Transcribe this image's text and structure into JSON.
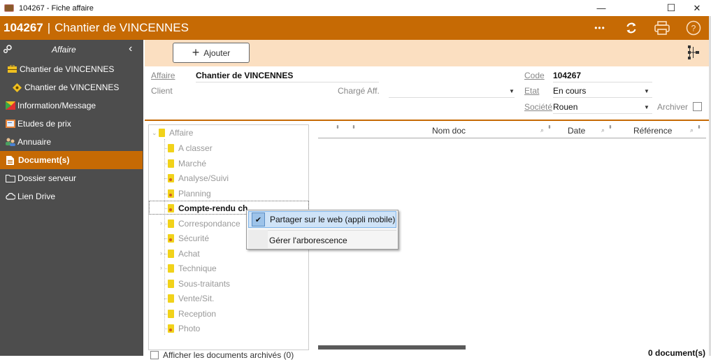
{
  "window": {
    "title": "104267 - Fiche affaire",
    "controls": {
      "minimize": "—",
      "maximize": "☐",
      "close": "✕"
    }
  },
  "header": {
    "code": "104267",
    "separator": "|",
    "name": "Chantier de VINCENNES",
    "icons": {
      "more": "•••",
      "refresh": "⟳",
      "print": "print-icon",
      "help": "?"
    }
  },
  "colors": {
    "accent": "#c66a04",
    "sidebar_bg": "#4d4d4d",
    "toolbar_bg": "#fbdfc1"
  },
  "sidebar": {
    "header_label": "Affaire",
    "collapse_glyph": "‹",
    "items": [
      {
        "label": "Chantier de VINCENNES",
        "icon": "briefcase-icon"
      },
      {
        "label": "Chantier de VINCENNES",
        "icon": "site-sign-icon"
      },
      {
        "label": "Information/Message",
        "icon": "message-flag-icon"
      },
      {
        "label": "Etudes de prix",
        "icon": "price-study-icon"
      },
      {
        "label": "Annuaire",
        "icon": "contacts-icon"
      },
      {
        "label": "Document(s)",
        "icon": "document-icon",
        "active": true
      },
      {
        "label": "Dossier serveur",
        "icon": "folder-icon"
      },
      {
        "label": "Lien Drive",
        "icon": "cloud-icon"
      }
    ]
  },
  "toolbar": {
    "add_label": "Ajouter",
    "add_glyph": "+"
  },
  "form": {
    "affaire_label": "Affaire",
    "affaire_value": "Chantier de VINCENNES",
    "client_label": "Client",
    "client_value": "",
    "charge_label": "Chargé Aff.",
    "charge_value": "",
    "code_label": "Code",
    "code_value": "104267",
    "etat_label": "Etat",
    "etat_value": "En cours",
    "societe_label": "Société",
    "societe_value": "Rouen",
    "archiver_label": "Archiver",
    "archiver_checked": false,
    "dropdown_glyph": "▼"
  },
  "tree": {
    "root": "Affaire",
    "nodes": [
      {
        "label": "A classer",
        "badge": false,
        "expandable": false
      },
      {
        "label": "Marché",
        "badge": false,
        "expandable": false
      },
      {
        "label": "Analyse/Suivi",
        "badge": true,
        "expandable": false
      },
      {
        "label": "Planning",
        "badge": true,
        "expandable": false
      },
      {
        "label": "Compte-rendu ch.",
        "badge": true,
        "expandable": false,
        "selected": true
      },
      {
        "label": "Correspondance",
        "badge": false,
        "expandable": true
      },
      {
        "label": "Sécurité",
        "badge": true,
        "expandable": false
      },
      {
        "label": "Achat",
        "badge": false,
        "expandable": true
      },
      {
        "label": "Technique",
        "badge": false,
        "expandable": true
      },
      {
        "label": "Sous-traitants",
        "badge": false,
        "expandable": false
      },
      {
        "label": "Vente/Sit.",
        "badge": false,
        "expandable": false
      },
      {
        "label": "Reception",
        "badge": false,
        "expandable": false
      },
      {
        "label": "Photo",
        "badge": true,
        "expandable": false
      }
    ],
    "show_archived_label": "Afficher les documents archivés (0)"
  },
  "grid": {
    "columns": [
      "Nom doc",
      "Date",
      "Référence"
    ],
    "count_label": "0 document(s)"
  },
  "context_menu": {
    "items": [
      {
        "label": "Partager sur le web (appli mobile)",
        "checked": true
      },
      {
        "label": "Gérer l'arborescence",
        "checked": false
      }
    ],
    "check_glyph": "✔"
  }
}
